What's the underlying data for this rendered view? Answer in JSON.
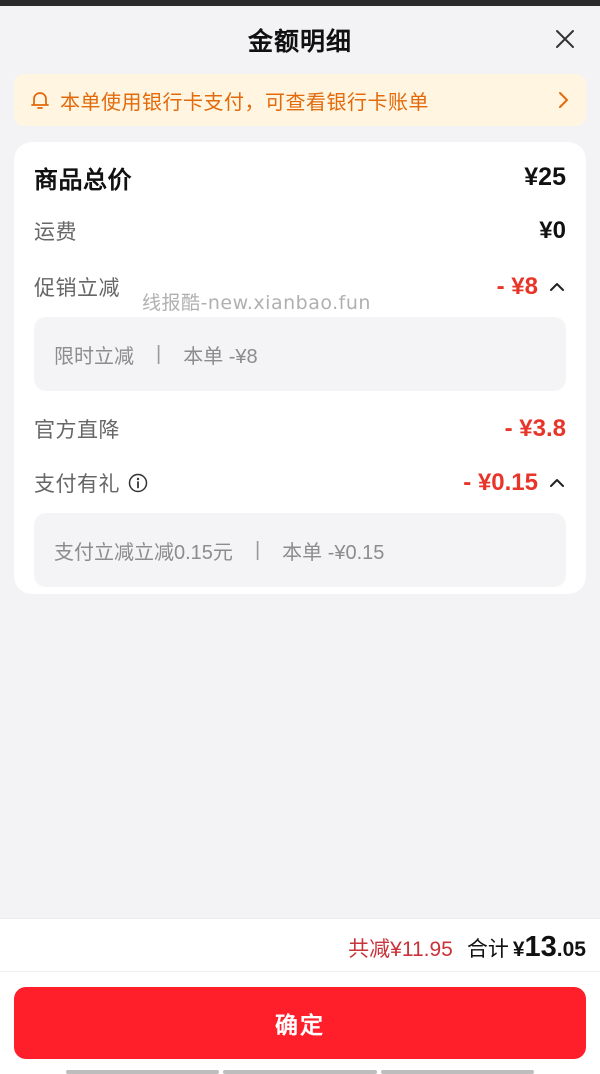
{
  "header": {
    "title": "金额明细",
    "close_icon": "close-icon"
  },
  "notice": {
    "text": "本单使用银行卡支付，可查看银行卡账单",
    "icon": "bell-icon",
    "arrow": "chevron-right-icon",
    "color": "#e36a0b",
    "bg": "#fff5e0"
  },
  "rows": {
    "goods_total": {
      "label": "商品总价",
      "value": "¥25"
    },
    "shipping": {
      "label": "运费",
      "value": "¥0"
    },
    "promo": {
      "label": "促销立减",
      "value": "- ¥8",
      "detail": {
        "name": "限时立减",
        "separator": "|",
        "amount": "本单 -¥8"
      }
    },
    "official_drop": {
      "label": "官方直降",
      "value": "- ¥3.8"
    },
    "payment_gift": {
      "label": "支付有礼",
      "value": "- ¥0.15",
      "info_icon": "info-icon",
      "detail": {
        "name": "支付立减立减0.15元",
        "separator": "|",
        "amount": "本单 -¥0.15"
      }
    }
  },
  "watermark": "线报酷-new.xianbao.fun",
  "footer": {
    "saved": "共减¥11.95",
    "total_label": "合计",
    "total_currency": "¥",
    "total_int": "13",
    "total_dec": ".05",
    "confirm_label": "确定"
  },
  "colors": {
    "accent_red": "#e8352a",
    "button_red": "#ff1f2b"
  }
}
